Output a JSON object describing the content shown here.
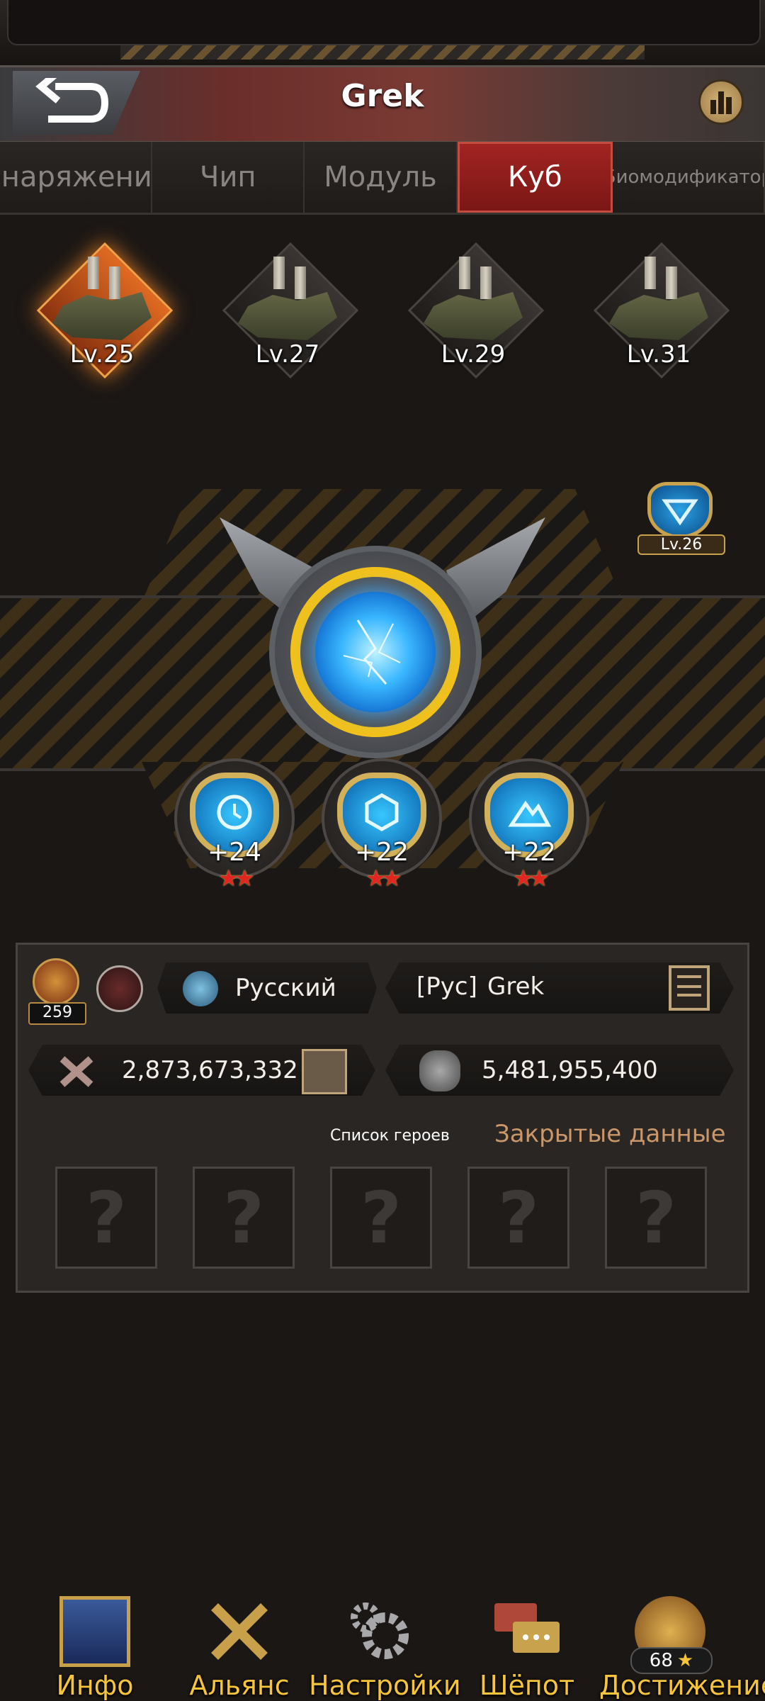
{
  "header": {
    "title": "Grek"
  },
  "tabs": [
    "Снаряжение",
    "Чип",
    "Модуль",
    "Куб",
    "Биомодификатор"
  ],
  "active_tab": "Куб",
  "factories": [
    {
      "level": "Lv.25",
      "active": true
    },
    {
      "level": "Lv.27",
      "active": false
    },
    {
      "level": "Lv.29",
      "active": false
    },
    {
      "level": "Lv.31",
      "active": false
    }
  ],
  "cube_badge": {
    "level": "Lv.26"
  },
  "sub_cubes": [
    {
      "icon": "clock-cube-icon",
      "bonus": "+24",
      "stars": "★★"
    },
    {
      "icon": "hexagon-cube-icon",
      "bonus": "+22",
      "stars": "★★"
    },
    {
      "icon": "mountain-cube-icon",
      "bonus": "+22",
      "stars": "★★"
    }
  ],
  "profile": {
    "likes": "259",
    "language": "Русский",
    "alliance_tag": "[Рус]",
    "player_name": "Grek",
    "power": "2,873,673,332",
    "kills": "5,481,955,400"
  },
  "heroes": {
    "title": "Список героев",
    "hidden_label": "Закрытые данные",
    "slots": [
      "?",
      "?",
      "?",
      "?",
      "?"
    ]
  },
  "nav": {
    "items": [
      "Инфо",
      "Альянс",
      "Настройки",
      "Шёпот",
      "Достижение"
    ],
    "achievement_count": "68"
  },
  "colors": {
    "accent_red": "#a22422",
    "gold": "#f5c43a",
    "hidden_label": "#c9976a"
  }
}
